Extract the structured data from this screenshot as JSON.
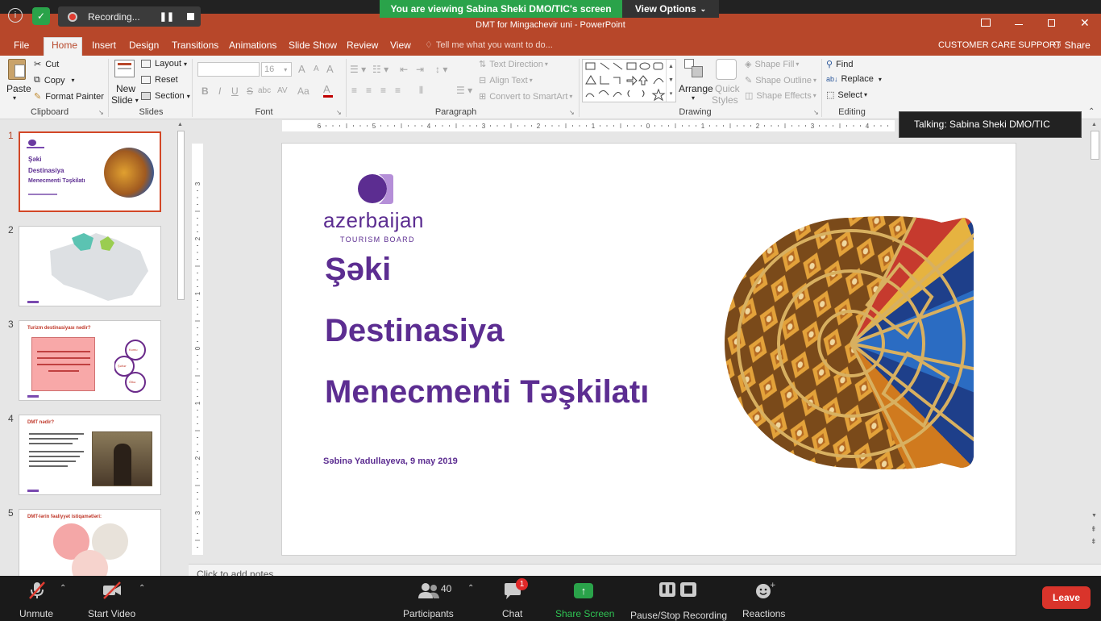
{
  "zoom_top": {
    "recording": "Recording...",
    "viewing_banner": "You are viewing Sabina Sheki DMO/TIC's screen",
    "view_options": "View Options"
  },
  "window": {
    "title": "DMT for Mingachevir uni  -  PowerPoint"
  },
  "menu": {
    "tabs": [
      "File",
      "Home",
      "Insert",
      "Design",
      "Transitions",
      "Animations",
      "Slide Show",
      "Review",
      "View"
    ],
    "active": "Home",
    "tell_me": "Tell me what you want to do...",
    "customer_care": "CUSTOMER CARE SUPPORT",
    "share": "Share"
  },
  "ribbon": {
    "clipboard": {
      "paste": "Paste",
      "cut": "Cut",
      "copy": "Copy",
      "format_painter": "Format Painter",
      "label": "Clipboard"
    },
    "slides": {
      "new_slide_1": "New",
      "new_slide_2": "Slide",
      "layout": "Layout",
      "reset": "Reset",
      "section": "Section",
      "label": "Slides"
    },
    "font": {
      "size": "16",
      "bold": "B",
      "italic": "I",
      "underline": "U",
      "strike": "S",
      "shadow": "abc",
      "spacing": "AV",
      "case": "Aa",
      "grow": "A",
      "shrink": "A",
      "clear": "A",
      "color": "A",
      "label": "Font"
    },
    "paragraph": {
      "text_direction": "Text Direction",
      "align_text": "Align Text",
      "smartart": "Convert to SmartArt",
      "label": "Paragraph"
    },
    "drawing": {
      "arrange": "Arrange",
      "quick_1": "Quick",
      "quick_2": "Styles",
      "shape_fill": "Shape Fill",
      "shape_outline": "Shape Outline",
      "shape_effects": "Shape Effects",
      "label": "Drawing"
    },
    "editing": {
      "find": "Find",
      "replace": "Replace",
      "select": "Select",
      "label": "Editing"
    }
  },
  "talking": "Talking: Sabina Sheki DMO/TIC",
  "ruler": {
    "h_ticks": [
      "6",
      "5",
      "4",
      "3",
      "2",
      "1",
      "0",
      "1",
      "2",
      "3",
      "4"
    ],
    "v_ticks": [
      "3",
      "2",
      "1",
      "0",
      "1",
      "2",
      "3"
    ]
  },
  "thumbnails": [
    {
      "num": "1",
      "t1": "Şəki",
      "t2": "Destinasiya",
      "t3": "Menecmenti Təşkilatı"
    },
    {
      "num": "2"
    },
    {
      "num": "3",
      "title": "Turizm destinasiyası nədir?",
      "w1": "Komu",
      "w2": "Şəhər",
      "w3": "Ölkə"
    },
    {
      "num": "4",
      "title": "DMT nədir?"
    },
    {
      "num": "5",
      "title": "DMT-lərin fəaliyyət istiqamətləri:"
    }
  ],
  "slide": {
    "logo_name": "azerbaijan",
    "logo_sub": "TOURISM BOARD",
    "line1": "Şəki",
    "line2": "Destinasiya",
    "line3": "Menecmenti Təşkilatı",
    "author": "Səbinə Yadullayeva, 9 may 2019",
    "accent": "#5c2d91"
  },
  "notes": "Click to add notes",
  "zoom_bottom": {
    "unmute": "Unmute",
    "start_video": "Start Video",
    "participants": "Participants",
    "participants_count": "40",
    "chat": "Chat",
    "chat_badge": "1",
    "share_screen": "Share Screen",
    "recording": "Pause/Stop Recording",
    "reactions": "Reactions",
    "leave": "Leave"
  }
}
